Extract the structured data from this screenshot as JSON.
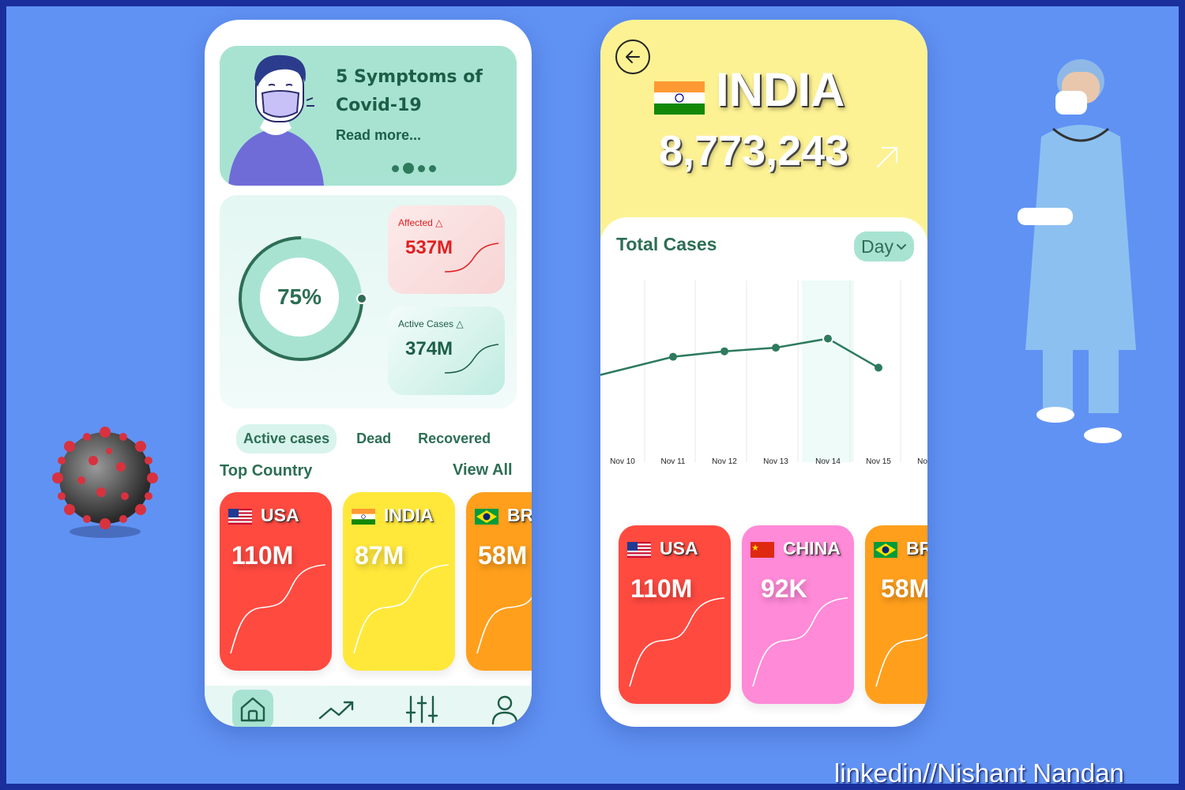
{
  "left_screen": {
    "banner": {
      "title": "5 Symptoms of Covid-19",
      "link": "Read more..."
    },
    "stats": {
      "progress_label": "75%",
      "progress_value": 0.75,
      "affected": {
        "label": "Affected",
        "value": "537M",
        "trend": "up",
        "color": "#e02020"
      },
      "active": {
        "label": "Active Cases",
        "value": "374M",
        "trend": "up",
        "color": "#1d5e47"
      }
    },
    "tabs": [
      {
        "label": "Active cases",
        "active": true
      },
      {
        "label": "Dead",
        "active": false
      },
      {
        "label": "Recovered",
        "active": false
      }
    ],
    "top_country": {
      "title": "Top Country",
      "view_all": "View All"
    },
    "countries": [
      {
        "name": "USA",
        "value": "110M",
        "flag": "us-flag",
        "color": "#ff4a40"
      },
      {
        "name": "INDIA",
        "value": "87M",
        "flag": "india-flag",
        "color": "#ffe83a"
      },
      {
        "name": "BR",
        "value": "58M",
        "flag": "brazil-flag",
        "color": "#ff9f1c"
      }
    ],
    "nav": [
      {
        "icon": "home-icon",
        "active": true
      },
      {
        "icon": "trending-icon",
        "active": false
      },
      {
        "icon": "sliders-icon",
        "active": false
      },
      {
        "icon": "user-icon",
        "active": false
      }
    ]
  },
  "right_screen": {
    "country": "INDIA",
    "total": "8,773,243",
    "chart_title": "Total Cases",
    "period": "Day",
    "chart_data": {
      "type": "line",
      "categories": [
        "Nov 10",
        "Nov 11",
        "Nov 12",
        "Nov 13",
        "Nov 14",
        "Nov 15",
        "Nov"
      ],
      "values": [
        null,
        58,
        61,
        63,
        68,
        52,
        null
      ],
      "highlighted": "Nov 14",
      "note_values": "relative units; axis has no printed scale"
    },
    "countries": [
      {
        "name": "USA",
        "value": "110M",
        "flag": "us-flag",
        "color": "#ff4a40"
      },
      {
        "name": "CHINA",
        "value": "92K",
        "flag": "china-flag",
        "color": "#ff8ad8"
      },
      {
        "name": "BR",
        "value": "58M",
        "flag": "brazil-flag",
        "color": "#ff9f1c"
      }
    ]
  },
  "credit": "linkedin//Nishant Nandan"
}
